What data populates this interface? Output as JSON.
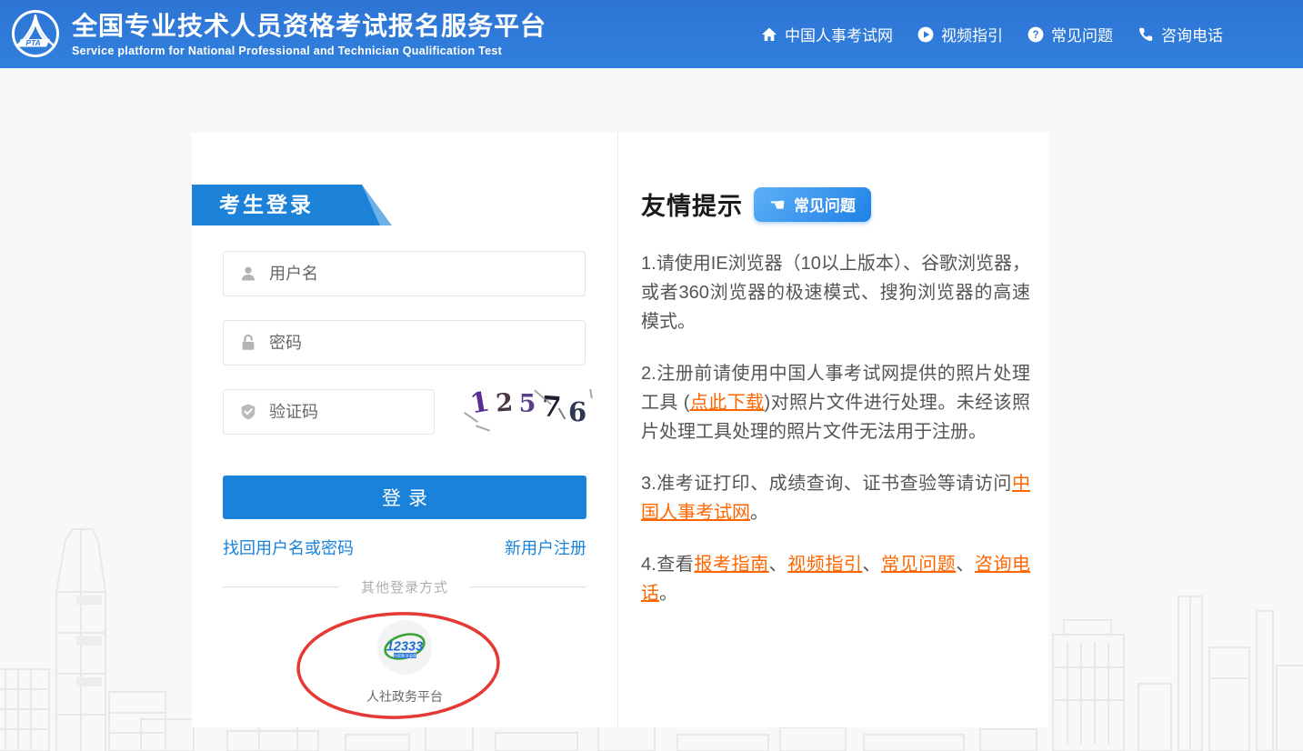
{
  "header": {
    "logo_text": "PTA",
    "title": "全国专业技术人员资格考试报名服务平台",
    "subtitle": "Service platform for National Professional and Technician Qualification Test",
    "nav": [
      {
        "icon": "home-icon",
        "label": "中国人事考试网"
      },
      {
        "icon": "play-circle-icon",
        "label": "视频指引"
      },
      {
        "icon": "question-circle-icon",
        "label": "常见问题"
      },
      {
        "icon": "phone-icon",
        "label": "咨询电话"
      }
    ]
  },
  "login": {
    "panel_title": "考生登录",
    "username_placeholder": "用户名",
    "password_placeholder": "密码",
    "captcha_placeholder": "验证码",
    "captcha_code": "12576",
    "login_button": "登录",
    "forgot_link": "找回用户名或密码",
    "register_link": "新用户注册",
    "other_login_label": "其他登录方式",
    "alt_login": {
      "logo_text": "12333",
      "label": "人社政务平台"
    }
  },
  "tips": {
    "title": "友情提示",
    "faq_button": "常见问题",
    "faq_button_icon": "☚",
    "paragraphs": [
      [
        {
          "t": "1.请使用IE浏览器（10以上版本）、谷歌浏览器，或者360浏览器的极速模式、搜狗浏览器的高速模式。"
        }
      ],
      [
        {
          "t": "2.注册前请使用中国人事考试网提供的照片处理工具 ("
        },
        {
          "t": "点此下载",
          "link": true
        },
        {
          "t": ")对照片文件进行处理。未经该照片处理工具处理的照片文件无法用于注册。"
        }
      ],
      [
        {
          "t": "3.准考证打印、成绩查询、证书查验等请访问"
        },
        {
          "t": "中国人事考试网",
          "link": true
        },
        {
          "t": "。"
        }
      ],
      [
        {
          "t": "4.查看"
        },
        {
          "t": "报考指南",
          "link": true
        },
        {
          "t": "、"
        },
        {
          "t": "视频指引",
          "link": true
        },
        {
          "t": "、"
        },
        {
          "t": "常见问题",
          "link": true
        },
        {
          "t": "、"
        },
        {
          "t": "咨询电话",
          "link": true
        },
        {
          "t": "。"
        }
      ]
    ]
  },
  "icons": {
    "header_nav": [
      "home-icon",
      "play-circle-icon",
      "question-circle-icon",
      "phone-icon"
    ],
    "login_fields": [
      "user-icon",
      "lock-open-icon",
      "shield-check-icon"
    ],
    "annotation": "red-circle-annotation"
  },
  "colors": {
    "header_blue": "#2f79da",
    "login_blue": "#1a82d8",
    "faq_gradient": [
      "#5eb0f7",
      "#1f81e6"
    ],
    "orange_link": "#ff6600",
    "blue_link": "#1a82d8",
    "annotation_red": "#e53935",
    "text_gray": "#555555",
    "page_bg": "#f7f8fa"
  }
}
